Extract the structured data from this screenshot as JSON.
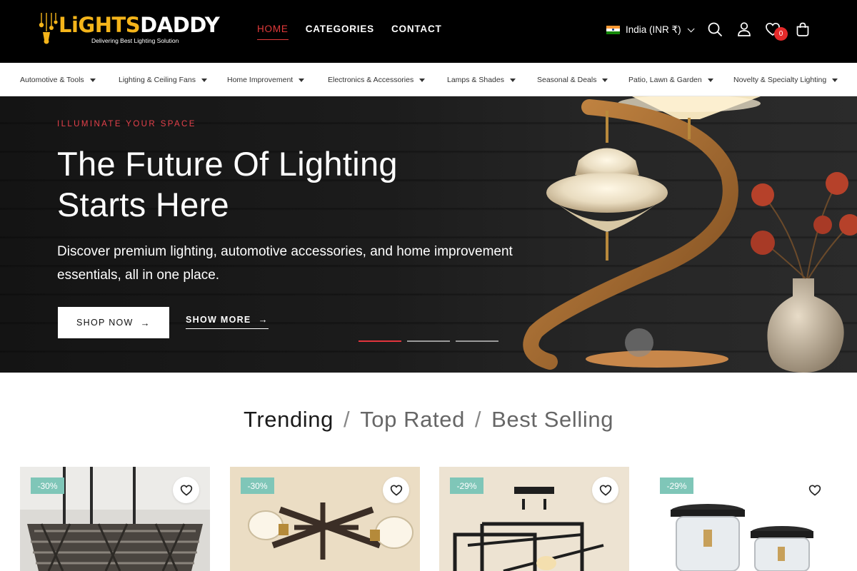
{
  "brand": {
    "name_part1": "LiGHTS",
    "name_part2": "DADDY",
    "tagline": "Delivering Best Lighting Solution"
  },
  "nav": {
    "items": [
      {
        "label": "HOME",
        "active": true
      },
      {
        "label": "CATEGORIES",
        "active": false
      },
      {
        "label": "CONTACT",
        "active": false
      }
    ]
  },
  "header": {
    "currency": "India (INR ₹)",
    "wishlist_count": "0",
    "icons": [
      "search-icon",
      "account-icon",
      "heart-icon",
      "bag-icon"
    ]
  },
  "categories": [
    "Automotive & Tools",
    "Lighting & Ceiling Fans",
    "Home Improvement",
    "Electronics & Accessories",
    "Lamps & Shades",
    "Seasonal & Deals",
    "Patio, Lawn & Garden",
    "Novelty & Specialty Lighting"
  ],
  "hero": {
    "kicker": "ILLUMINATE YOUR SPACE",
    "title_line1": "The Future Of Lighting",
    "title_line2": "Starts Here",
    "subtitle_line1": "Discover premium lighting, automotive accessories, and home improvement",
    "subtitle_line2": "essentials, all in one place.",
    "shop_label": "SHOP NOW",
    "more_label": "SHOW MORE",
    "slides": 3,
    "active_slide": 1
  },
  "product_tabs": {
    "items": [
      "Trending",
      "Top Rated",
      "Best Selling"
    ],
    "active": "Trending"
  },
  "products": [
    {
      "discount": "-30%"
    },
    {
      "discount": "-30%"
    },
    {
      "discount": "-29%"
    },
    {
      "discount": "-29%"
    }
  ],
  "colors": {
    "accent": "#e23a3a",
    "discount_badge": "#7fc6b8",
    "logo_yellow": "#f4b41a"
  }
}
